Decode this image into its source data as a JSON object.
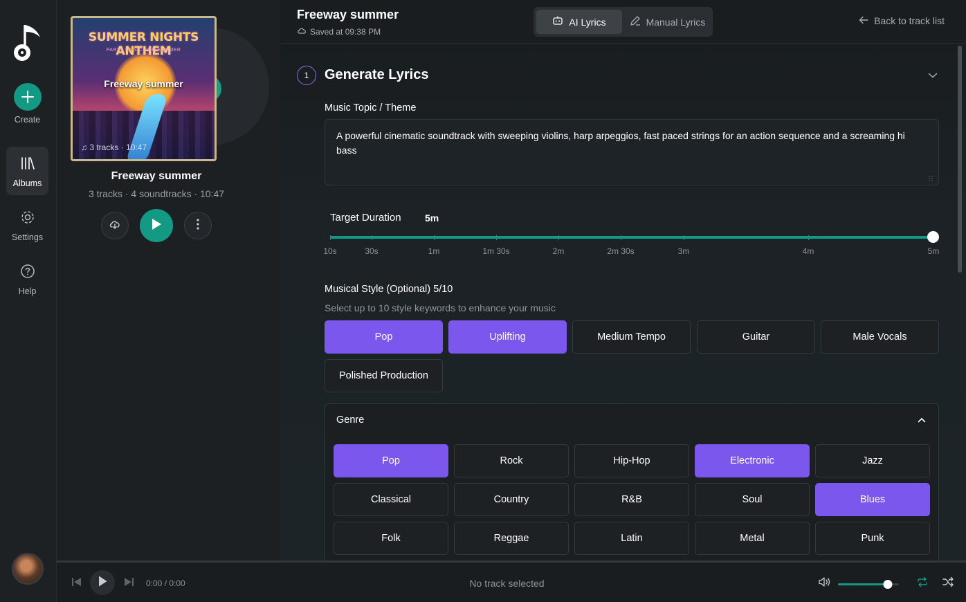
{
  "rail": {
    "create_label": "Create",
    "albums_label": "Albums",
    "settings_label": "Settings",
    "help_label": "Help"
  },
  "album": {
    "cover_title": "SUMMER NIGHTS ANTHEM",
    "cover_subtitle": "PARTY MUSIC FOR SUMMER",
    "cover_name": "Freeway summer",
    "cover_meta": "3 tracks · 10:47",
    "name": "Freeway summer",
    "meta": "3 tracks · 4 soundtracks · 10:47"
  },
  "header": {
    "title": "Freeway summer",
    "saved": "Saved at 09:38 PM",
    "tab_ai": "AI Lyrics",
    "tab_manual": "Manual Lyrics",
    "back": "Back to track list"
  },
  "generate": {
    "step": "1",
    "title": "Generate Lyrics",
    "topic_label": "Music Topic / Theme",
    "topic_value": "A powerful cinematic soundtrack with sweeping violins, harp arpeggios, fast paced strings for an action sequence and a screaming hi bass",
    "duration_label": "Target Duration",
    "duration_value": "5m",
    "duration_ticks": [
      "10s",
      "30s",
      "1m",
      "1m 30s",
      "2m",
      "2m 30s",
      "3m",
      "4m",
      "5m"
    ],
    "style_label": "Musical Style (Optional) 5/10",
    "style_hint": "Select up to 10 style keywords to enhance your music",
    "styles": [
      {
        "label": "Pop",
        "selected": true
      },
      {
        "label": "Uplifting",
        "selected": true
      },
      {
        "label": "Medium Tempo",
        "selected": false
      },
      {
        "label": "Guitar",
        "selected": false
      },
      {
        "label": "Male Vocals",
        "selected": false
      },
      {
        "label": "Polished Production",
        "selected": false
      }
    ],
    "genre_label": "Genre",
    "genres": [
      {
        "label": "Pop",
        "selected": true
      },
      {
        "label": "Rock",
        "selected": false
      },
      {
        "label": "Hip-Hop",
        "selected": false
      },
      {
        "label": "Electronic",
        "selected": true
      },
      {
        "label": "Jazz",
        "selected": false
      },
      {
        "label": "Classical",
        "selected": false
      },
      {
        "label": "Country",
        "selected": false
      },
      {
        "label": "R&B",
        "selected": false
      },
      {
        "label": "Soul",
        "selected": false
      },
      {
        "label": "Blues",
        "selected": true
      },
      {
        "label": "Folk",
        "selected": false
      },
      {
        "label": "Reggae",
        "selected": false
      },
      {
        "label": "Latin",
        "selected": false
      },
      {
        "label": "Metal",
        "selected": false
      },
      {
        "label": "Punk",
        "selected": false
      }
    ]
  },
  "player": {
    "time": "0:00 / 0:00",
    "status": "No track selected",
    "volume": 0.82
  },
  "colors": {
    "accent_teal": "#129a85",
    "accent_purple": "#7b57ee"
  }
}
